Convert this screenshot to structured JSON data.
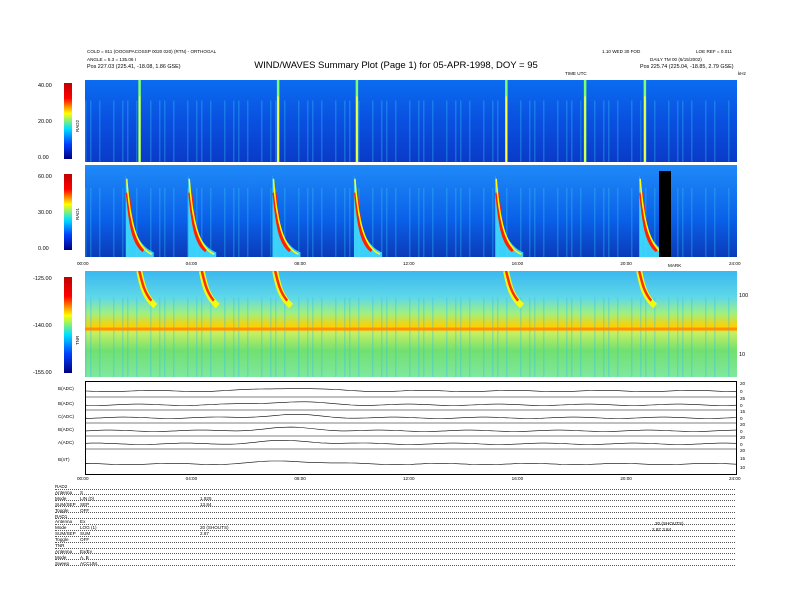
{
  "header": {
    "left_line1": "COLD = 811 (OOOSPACOSSP 0020 020) (RTN) - ORTHOGAL",
    "left_line2": "ANGLE = 5.3 = 135.06 I",
    "left_line3": "Pos    227.03 (225.41, -18.08, 1.86 GSE)",
    "right_line1": "1.10 WED 30 FOD",
    "right_line2": "LOE REF = 0.011",
    "right_line3": "DAILY TM 00 (6/15/2002)",
    "right_line4": "Pos    225.74 (225.04, -18.85, 2.79 GSE)",
    "time_utc": "TIME UTC",
    "khz": "kHz"
  },
  "title": "WIND/WAVES Summary Plot (Page 1) for 05-APR-1998, DOY = 95",
  "panels": {
    "rad2": {
      "label": "RAD2",
      "ticks": [
        "40.00",
        "20.00",
        "0.00"
      ]
    },
    "rad1": {
      "label": "RAD1",
      "ticks": [
        "60.00",
        "30.00",
        "0.00"
      ]
    },
    "tnr": {
      "label": "TNR",
      "ticks": [
        "-125.00",
        "-140.00",
        "-155.00"
      ],
      "right_ticks": [
        "100",
        "10"
      ]
    },
    "time_ticks": [
      "00:00",
      "04:00",
      "08:00",
      "12:00",
      "16:00",
      "20:00",
      "24:00"
    ],
    "marker": "MARK",
    "lines": [
      {
        "label": "B(ADC)",
        "ticks": [
          "20",
          "0"
        ]
      },
      {
        "label": "B(ADC)",
        "ticks": [
          "25",
          "0"
        ]
      },
      {
        "label": "C(ADC)",
        "ticks": [
          "15",
          "0"
        ]
      },
      {
        "label": "B(ADC)",
        "ticks": [
          "20",
          "0"
        ]
      },
      {
        "label": "A(ADC)",
        "ticks": [
          "20",
          "0"
        ]
      },
      {
        "label": "B(nT)",
        "ticks": [
          "20",
          "15",
          "10"
        ]
      }
    ],
    "bottom_time_ticks": [
      "00:00",
      "04:00",
      "08:00",
      "12:00",
      "16:00",
      "20:00",
      "24:00"
    ]
  },
  "footer": {
    "rows": [
      {
        "a": "RAD2",
        "b": "",
        "c": ""
      },
      {
        "a": "Antenna",
        "b": "S",
        "c": ""
      },
      {
        "a": "Mode",
        "b": "LIN (0)",
        "c": "1.925"
      },
      {
        "a": "SUM/SEP",
        "b": "SEP",
        "c": "13.84"
      },
      {
        "a": "Toggle",
        "b": "OFF",
        "c": ""
      },
      {
        "a": "RAD1",
        "b": "",
        "c": ""
      },
      {
        "a": "Antenna",
        "b": "Ex",
        "c": ""
      },
      {
        "a": "Mode",
        "b": "LOG (1)",
        "c": "20 (SHOUTS)"
      },
      {
        "a": "SUM/SEP",
        "b": "SUM",
        "c": "2.87"
      },
      {
        "a": "Toggle",
        "b": "OFF",
        "c": ""
      },
      {
        "a": "TNR",
        "b": "",
        "c": ""
      },
      {
        "a": "Antenna",
        "b": "Ex/Ey",
        "c": ""
      },
      {
        "a": "Mode",
        "b": "A, B",
        "c": ""
      },
      {
        "a": "Sweep",
        "b": "ACCUM.",
        "c": ""
      }
    ],
    "right_note_1": "20 (SHOUTS)",
    "right_note_2": "2.87        3.84"
  },
  "chart_data": [
    {
      "type": "heatmap",
      "title": "WIND/WAVES Summary Plot (Page 1) for 05-APR-1998, DOY = 95",
      "panel": "RAD2",
      "xlabel": "TIME UTC",
      "x_range": [
        "00:00",
        "24:00"
      ],
      "colorbar_range": [
        0,
        40
      ],
      "colorbar_ticks": [
        40,
        20,
        0
      ],
      "burst_hours": [
        2.0,
        7.1,
        10.0,
        15.5,
        18.4,
        20.6
      ]
    },
    {
      "type": "heatmap",
      "panel": "RAD1",
      "x_range": [
        "00:00",
        "24:00"
      ],
      "colorbar_range": [
        0,
        60
      ],
      "colorbar_ticks": [
        60,
        30,
        0
      ],
      "burst_hours": [
        1.5,
        3.8,
        6.9,
        9.9,
        15.1,
        20.4
      ]
    },
    {
      "type": "heatmap",
      "panel": "TNR",
      "x_range": [
        "00:00",
        "24:00"
      ],
      "colorbar_range": [
        -155,
        -125
      ],
      "colorbar_ticks": [
        -125,
        -140,
        -155
      ],
      "right_ticks": [
        "100",
        "10"
      ],
      "plasma_line_fraction": 0.42,
      "burst_hours": [
        2.0,
        4.3,
        7.0,
        15.5,
        20.4
      ]
    }
  ]
}
